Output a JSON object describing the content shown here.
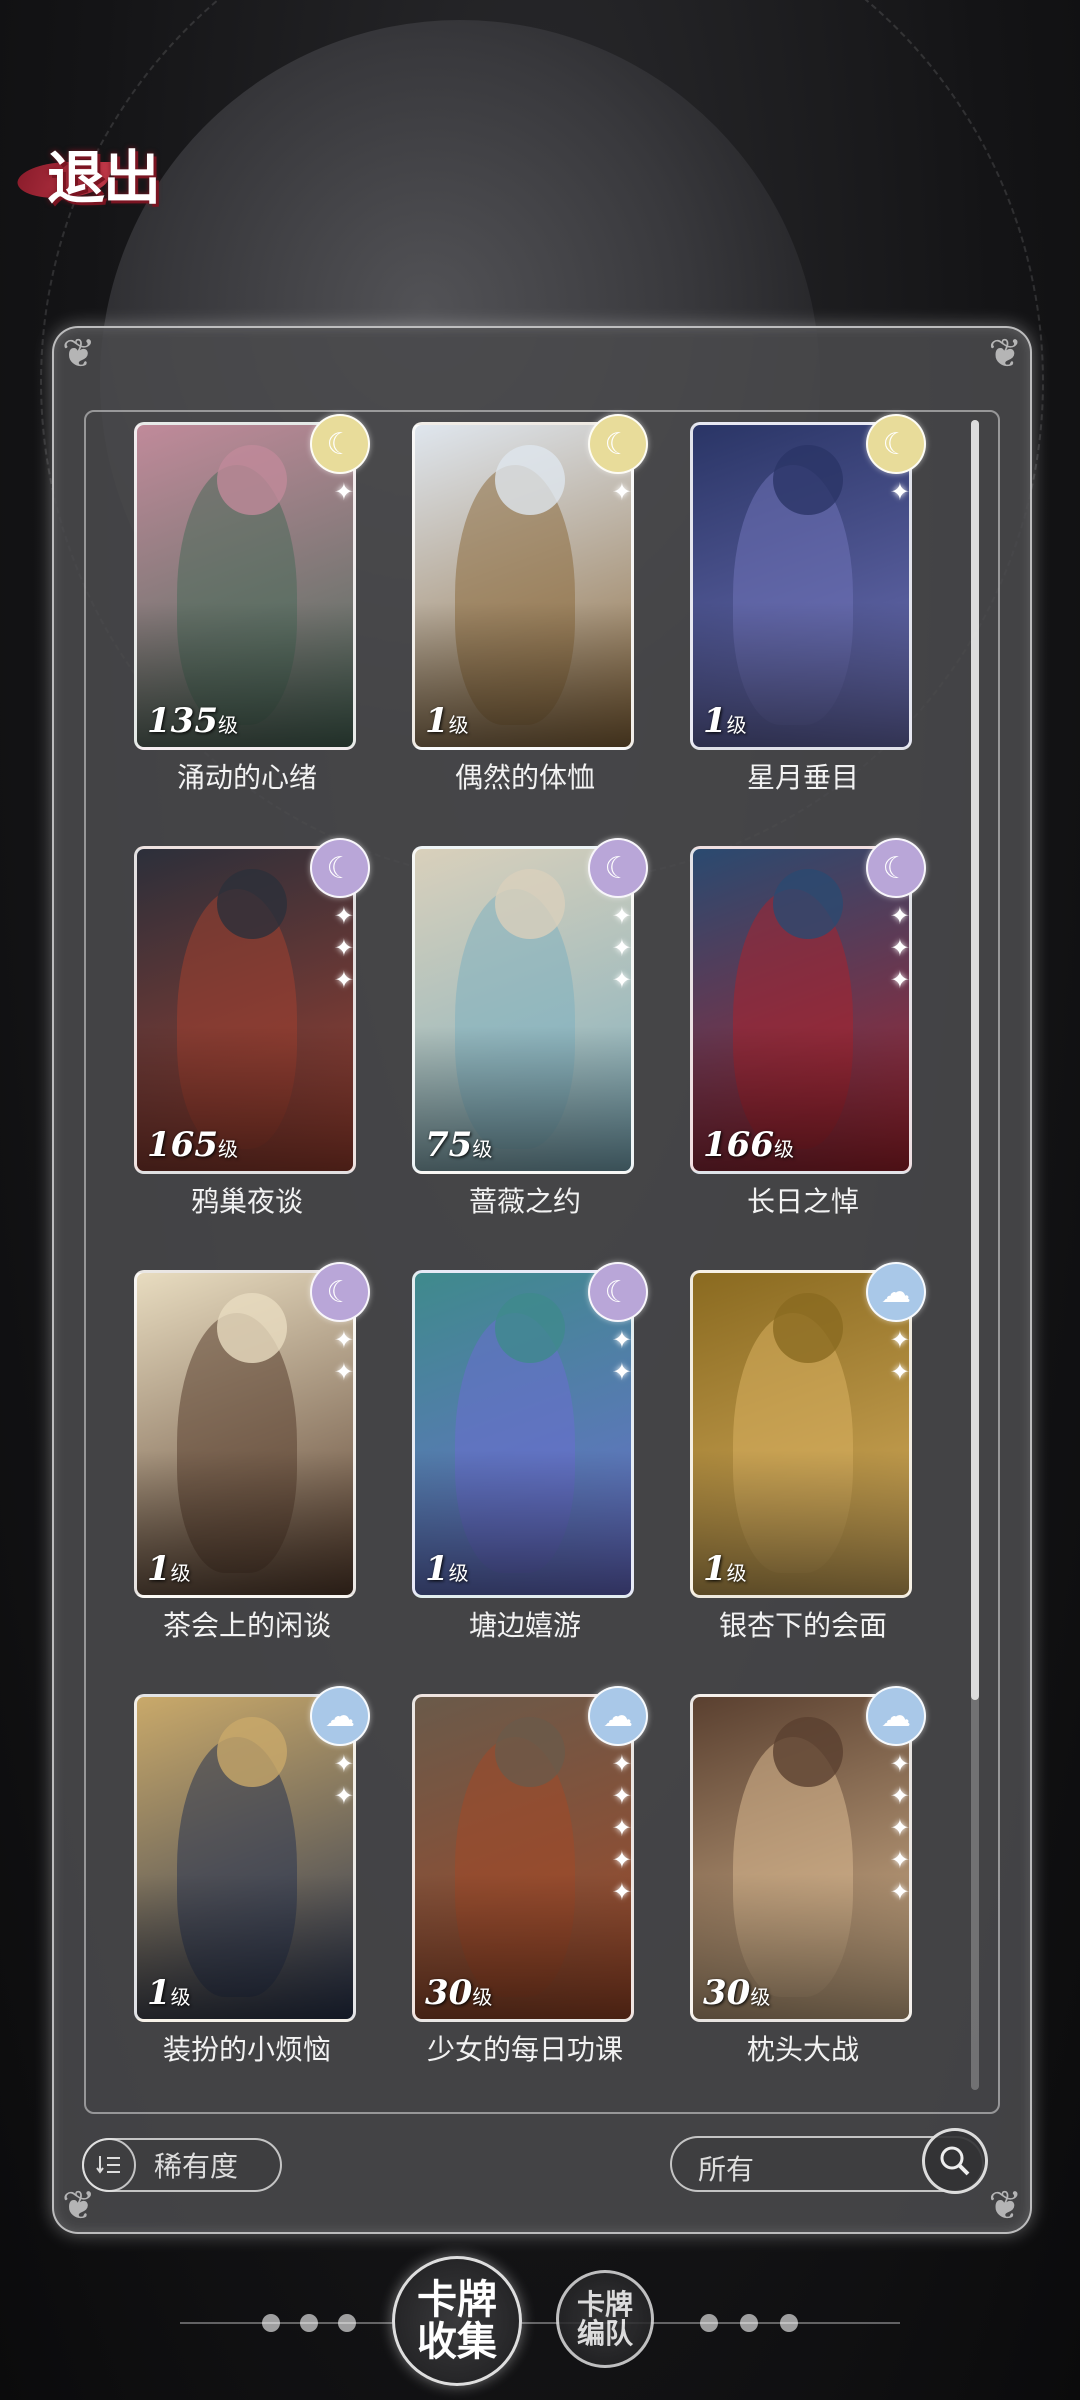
{
  "header": {
    "exit_label": "退出"
  },
  "cards": [
    {
      "name": "涌动的心绪",
      "level_num": "135",
      "level_unit": "级",
      "rarity": "gold",
      "rarity_icon": "moon-icon",
      "stars": 1,
      "palette": [
        "#c08a9a",
        "#4a6a5a"
      ]
    },
    {
      "name": "偶然的体恤",
      "level_num": "1",
      "level_unit": "级",
      "rarity": "gold",
      "rarity_icon": "moon-icon",
      "stars": 1,
      "palette": [
        "#dfe6ee",
        "#8d6b3e"
      ]
    },
    {
      "name": "星月垂目",
      "level_num": "1",
      "level_unit": "级",
      "rarity": "gold",
      "rarity_icon": "moon-icon",
      "stars": 1,
      "palette": [
        "#2a3566",
        "#6f72b8"
      ]
    },
    {
      "name": "鸦巢夜谈",
      "level_num": "165",
      "level_unit": "级",
      "rarity": "purple",
      "rarity_icon": "moon-icon",
      "stars": 3,
      "palette": [
        "#2c2f3a",
        "#a04030"
      ]
    },
    {
      "name": "蔷薇之约",
      "level_num": "75",
      "level_unit": "级",
      "rarity": "purple",
      "rarity_icon": "moon-icon",
      "stars": 3,
      "palette": [
        "#d9d0bb",
        "#7fb0c0"
      ]
    },
    {
      "name": "长日之悼",
      "level_num": "166",
      "level_unit": "级",
      "rarity": "purple",
      "rarity_icon": "moon-icon",
      "stars": 3,
      "palette": [
        "#2a4a70",
        "#a8232e"
      ]
    },
    {
      "name": "茶会上的闲谈",
      "level_num": "1",
      "level_unit": "级",
      "rarity": "purple",
      "rarity_icon": "moon-icon",
      "stars": 2,
      "palette": [
        "#e8dcc0",
        "#5a4030"
      ]
    },
    {
      "name": "塘边嬉游",
      "level_num": "1",
      "level_unit": "级",
      "rarity": "purple",
      "rarity_icon": "moon-icon",
      "stars": 2,
      "palette": [
        "#3f8a8c",
        "#6a6ed0"
      ]
    },
    {
      "name": "银杏下的会面",
      "level_num": "1",
      "level_unit": "级",
      "rarity": "blue",
      "rarity_icon": "cloud-icon",
      "stars": 2,
      "palette": [
        "#8a6a20",
        "#d8b060"
      ]
    },
    {
      "name": "装扮的小烦恼",
      "level_num": "1",
      "level_unit": "级",
      "rarity": "blue",
      "rarity_icon": "cloud-icon",
      "stars": 2,
      "palette": [
        "#c9a96a",
        "#2a3550"
      ]
    },
    {
      "name": "少女的每日功课",
      "level_num": "30",
      "level_unit": "级",
      "rarity": "blue",
      "rarity_icon": "cloud-icon",
      "stars": 5,
      "palette": [
        "#6a5a4a",
        "#a04828"
      ]
    },
    {
      "name": "枕头大战",
      "level_num": "30",
      "level_unit": "级",
      "rarity": "blue",
      "rarity_icon": "cloud-icon",
      "stars": 5,
      "palette": [
        "#5a4030",
        "#d8b890"
      ]
    }
  ],
  "footer": {
    "sort_label": "稀有度",
    "sort_icon": "sort-icon",
    "filter_label": "所有",
    "search_icon": "search-icon"
  },
  "tabs": {
    "collection_label": "卡牌收集",
    "team_label": "卡牌编队"
  },
  "colors": {
    "gold": "#e8dc9a",
    "purple": "#b9a6d8",
    "blue": "#a9c8e8",
    "exit_accent": "#7a1522"
  }
}
